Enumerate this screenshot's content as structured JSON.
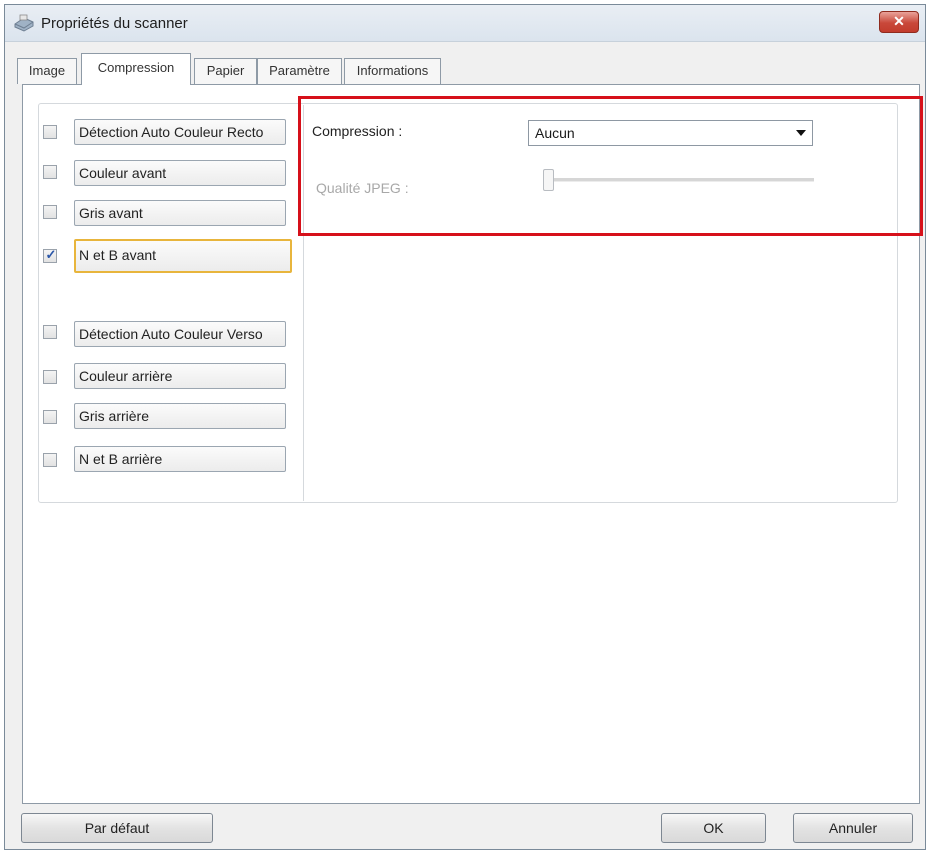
{
  "window": {
    "title": "Propriétés du scanner",
    "close_label": "✕"
  },
  "tabs": [
    {
      "label": "Image"
    },
    {
      "label": "Compression"
    },
    {
      "label": "Papier"
    },
    {
      "label": "Paramètre"
    },
    {
      "label": "Informations"
    }
  ],
  "active_tab": "Compression",
  "options": [
    {
      "label": "Détection Auto Couleur Recto",
      "checked": false
    },
    {
      "label": "Couleur avant",
      "checked": false
    },
    {
      "label": "Gris avant",
      "checked": false
    },
    {
      "label": "N et B avant",
      "checked": true,
      "selected": true
    },
    {
      "label": "Détection Auto Couleur Verso",
      "checked": false
    },
    {
      "label": "Couleur arrière",
      "checked": false
    },
    {
      "label": "Gris arrière",
      "checked": false
    },
    {
      "label": "N et B arrière",
      "checked": false
    }
  ],
  "compression": {
    "label": "Compression :",
    "value": "Aucun",
    "quality_label": "Qualité JPEG :",
    "quality_enabled": false,
    "quality_value": 0
  },
  "buttons": {
    "default_label": "Par défaut",
    "ok_label": "OK",
    "cancel_label": "Annuler"
  },
  "colors": {
    "highlight": "#d6101a",
    "selected_border": "#e8b53c",
    "check_color": "#2a56a8"
  },
  "icons": [
    "scanner-icon",
    "close-icon",
    "checkmark-icon",
    "dropdown-arrow-icon"
  ]
}
